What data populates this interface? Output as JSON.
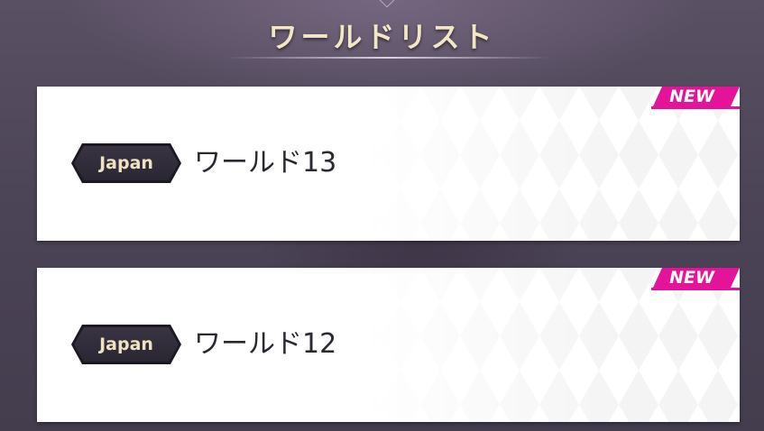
{
  "header": {
    "title": "ワールドリスト"
  },
  "worlds": [
    {
      "region": "Japan",
      "name": "ワールド13",
      "badge": "NEW"
    },
    {
      "region": "Japan",
      "name": "ワールド12",
      "badge": "NEW"
    }
  ],
  "colors": {
    "title_text": "#f3e6c4",
    "new_badge": "#e3149a",
    "region_badge_bg": "#2a2632",
    "region_badge_text": "#efe2c0",
    "card_bg": "#ffffff",
    "world_text": "#2a2830"
  }
}
